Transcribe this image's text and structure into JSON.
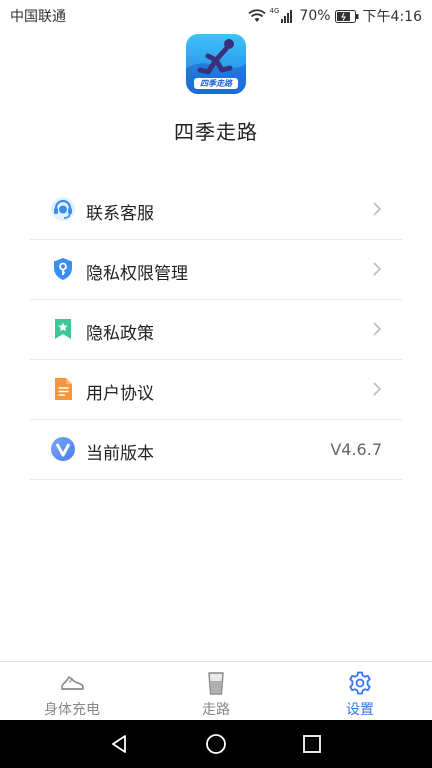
{
  "status_bar": {
    "carrier": "中国联通",
    "network": "4G",
    "battery": "70%",
    "time": "下午4:16"
  },
  "header": {
    "logo_text": "四季走路",
    "app_name": "四季走路"
  },
  "menu": {
    "items": [
      {
        "label": "联系客服",
        "icon": "headset-icon",
        "color": "#3a8ef0"
      },
      {
        "label": "隐私权限管理",
        "icon": "shield-key-icon",
        "color": "#3a8ef0"
      },
      {
        "label": "隐私政策",
        "icon": "bookmark-star-icon",
        "color": "#3cc79a"
      },
      {
        "label": "用户协议",
        "icon": "document-icon",
        "color": "#f5963a"
      },
      {
        "label": "当前版本",
        "icon": "v-badge-icon",
        "color": "#5b8ef3",
        "value": "V4.6.7"
      }
    ]
  },
  "tabs": [
    {
      "label": "身体充电",
      "icon": "shoe-icon",
      "active": false
    },
    {
      "label": "走路",
      "icon": "cup-icon",
      "active": false
    },
    {
      "label": "设置",
      "icon": "gear-icon",
      "active": true
    }
  ],
  "colors": {
    "accent": "#3b74ee",
    "divider": "#e9e9e9",
    "inactive_tab": "#888888"
  }
}
